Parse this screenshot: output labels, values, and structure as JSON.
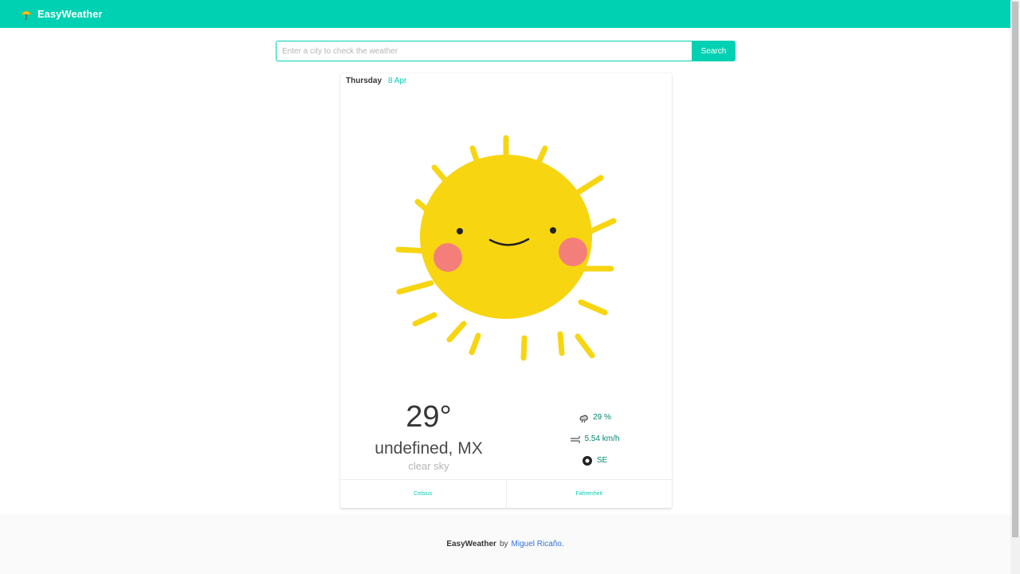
{
  "navbar": {
    "brand": "EasyWeather",
    "icon": "umbrella-icon",
    "color": "#00d1b2"
  },
  "search": {
    "placeholder": "Enter a city to check the weather",
    "value": "",
    "button_label": "Search"
  },
  "card": {
    "day": "Thursday",
    "date": "8 Apr",
    "image": "smiling-sun-icon",
    "temperature": "29°",
    "location": "undefined, MX",
    "description": "clear sky",
    "humidity": "29 %",
    "wind_speed": "5.54 km/h",
    "wind_direction": "SE",
    "units": {
      "celsius": "Celsius",
      "fahrenheit": "Fahrenheit"
    }
  },
  "footer": {
    "app_name": "EasyWeather",
    "by": "by",
    "author": "Miguel Ricaño",
    "end": "."
  }
}
